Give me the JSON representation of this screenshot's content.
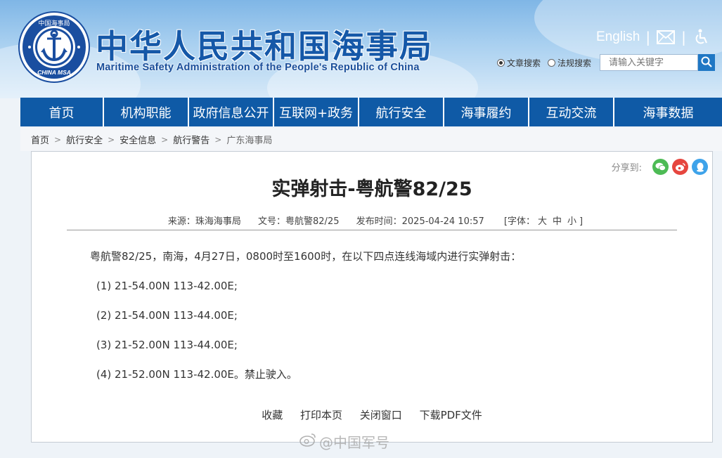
{
  "header": {
    "title_cn": "中华人民共和国海事局",
    "title_en": "Maritime Safety Administration of the People's Republic of China",
    "logo_text_top": "中国海事局",
    "logo_text_bottom": "CHINA MSA",
    "english_link": "English",
    "mail_icon": "mail-icon",
    "accessibility_icon": "accessibility-icon"
  },
  "search": {
    "option_article": "文章搜索",
    "option_law": "法规搜索",
    "selected": "文章搜索",
    "placeholder": "请输入关键字",
    "button_icon": "search-icon"
  },
  "nav": {
    "items": [
      "首页",
      "机构职能",
      "政府信息公开",
      "互联网+政务",
      "航行安全",
      "海事履约",
      "互动交流",
      "海事数据"
    ]
  },
  "breadcrumb": [
    "首页",
    "航行安全",
    "安全信息",
    "航行警告",
    "广东海事局"
  ],
  "share": {
    "label": "分享到:",
    "icons": [
      "wechat-icon",
      "weibo-icon",
      "qq-icon"
    ],
    "colors": [
      "#4dbb55",
      "#e6463f",
      "#3ea3ea"
    ]
  },
  "article": {
    "title": "实弹射击-粤航警82/25",
    "meta": {
      "source": "来源：珠海海事局",
      "doc_no": "文号：粤航警82/25",
      "publish_time": "发布时间：2025-04-24 10:57",
      "font_label": "[字体：",
      "font_large": "大",
      "font_medium": "中",
      "font_small": "小",
      "font_close": "]"
    },
    "intro": "粤航警82/25，南海，4月27日，0800时至1600时，在以下四点连线海域内进行实弹射击：",
    "points": [
      "(1)  21-54.00N 113-42.00E;",
      "(2)  21-54.00N 113-44.00E;",
      "(3)  21-52.00N 113-44.00E;",
      "(4)  21-52.00N 113-42.00E。禁止驶入。"
    ]
  },
  "actions": [
    "收藏",
    "打印本页",
    "关闭窗口",
    "下载PDF文件"
  ],
  "watermark": "@中国军号",
  "colors": {
    "nav_bg": "#0f5aa6",
    "title_blue": "#1558a8"
  }
}
